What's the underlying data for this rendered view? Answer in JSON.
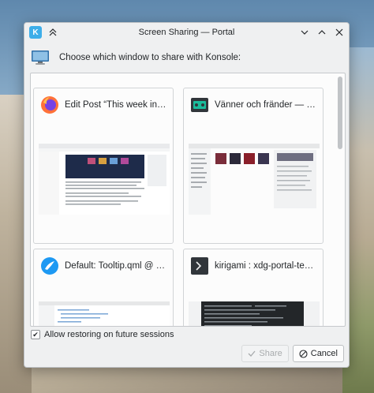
{
  "window": {
    "title": "Screen Sharing — Portal",
    "prompt": "Choose which window to share with Konsole:"
  },
  "icons": {
    "app": "kde-icon",
    "keep_above": "chevron-up-double-icon",
    "minimize": "chevron-down-icon",
    "maximize": "chevron-up-icon",
    "close": "close-icon",
    "monitor": "monitor-icon"
  },
  "windows": [
    {
      "title": "Edit Post “This week in K...",
      "icon": "firefox-icon"
    },
    {
      "title": "Vänner och fränder — Eli...",
      "icon": "media-player-icon"
    },
    {
      "title": "Default: Tooltip.qml @ ~/...",
      "icon": "kate-icon"
    },
    {
      "title": "kirigami : xdg-portal-test ...",
      "icon": "terminal-icon"
    }
  ],
  "restore": {
    "label": "Allow restoring on future sessions",
    "checked": true
  },
  "buttons": {
    "share": "Share",
    "cancel": "Cancel"
  },
  "colors": {
    "accent": "#3daee9",
    "window_bg": "#eff0f1",
    "view_bg": "#fcfcfc"
  }
}
